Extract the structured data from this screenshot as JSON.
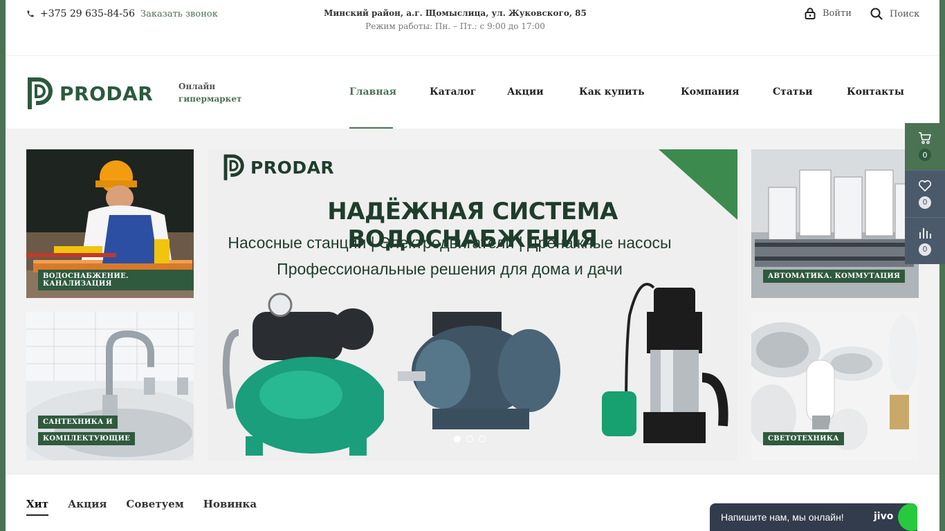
{
  "topbar": {
    "phone": "+375 29 635-84-56",
    "callback": "Заказать звонок",
    "address": "Минский район, а.г. Щомыслица, ул. Жуковского, 85",
    "hours": "Режим работы: Пн. – Пт.: с 9:00 до 17:00",
    "login": "Войти",
    "search": "Поиск"
  },
  "header": {
    "logo": "PRODAR",
    "tagline_line1": "Онлайн",
    "tagline_line2": "гипермаркет",
    "nav": [
      {
        "label": "Главная",
        "active": true
      },
      {
        "label": "Каталог"
      },
      {
        "label": "Акции"
      },
      {
        "label": "Как купить"
      },
      {
        "label": "Компания"
      },
      {
        "label": "Статьи"
      },
      {
        "label": "Контакты"
      }
    ]
  },
  "tiles": [
    {
      "label": "ВОДОСНАБЖЕНИЕ. КАНАЛИЗАЦИЯ"
    },
    {
      "label_line1": "САНТЕХНИКА И",
      "label_line2": "КОМПЛЕКТУЮЩИЕ"
    },
    {
      "label": "АВТОМАТИКА. КОММУТАЦИЯ"
    },
    {
      "label": "СВЕТОТЕХНИКА"
    }
  ],
  "banner": {
    "logo": "PRODAR",
    "title": "НАДЁЖНАЯ СИСТЕМА ВОДОСНАБЖЕНИЯ",
    "subtitle1": "Насосные станции | Электродвигатели | Дренажные насосы",
    "subtitle2": "Профессиональные решения для дома и дачи"
  },
  "side_panel": {
    "cart_count": "0",
    "favorites_count": "0",
    "compare_count": "0"
  },
  "tabs": [
    {
      "label": "Хит",
      "active": true
    },
    {
      "label": "Акция"
    },
    {
      "label": "Советуем"
    },
    {
      "label": "Новинка"
    }
  ],
  "chat": {
    "text": "Напишите нам, мы онлайн!",
    "brand": "jivo"
  },
  "colors": {
    "brand_green": "#4a7253",
    "dark_green": "#2f5a3d",
    "side_gray": "#4a5a6b",
    "chat_bg": "#333c4d"
  }
}
